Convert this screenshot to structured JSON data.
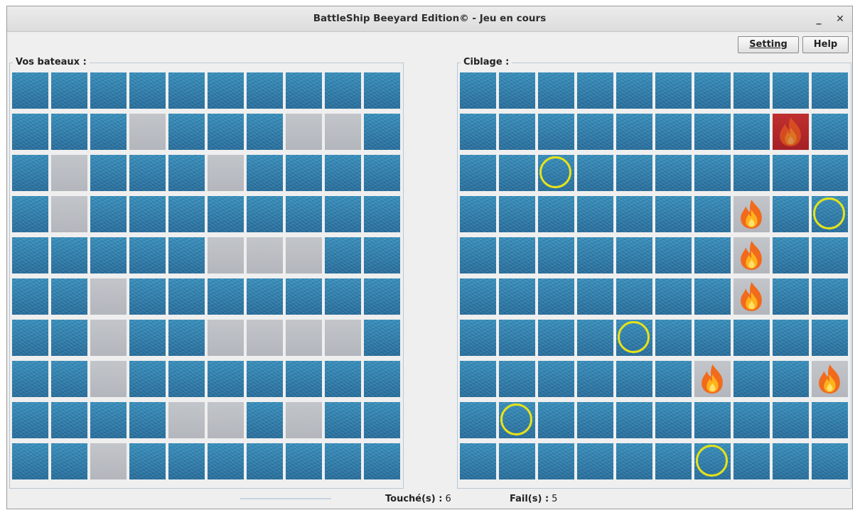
{
  "window": {
    "title": "BattleShip Beeyard Edition© - Jeu en cours",
    "minimize_glyph": "_",
    "close_glyph": "✕"
  },
  "toolbar": {
    "setting_label": "Setting",
    "help_label": "Help"
  },
  "left_panel": {
    "title": "Vos bateaux :",
    "grid": [
      "wwwwwwwwww",
      "wwwswwwssw",
      "wswwwswwww",
      "wswwwwwwww",
      "wwwwwsssww",
      "wwswwwwwww",
      "wwswwssssw",
      "wwswwwwwww",
      "wwwwsswsww",
      "wwswwwwwww"
    ]
  },
  "right_panel": {
    "title": "Ciblage :",
    "grid": [
      "wwwwwwwwww",
      "wwwwwwwwXw",
      "wwowwwwwww",
      "wwwwwwwhwo",
      "wwwwwwwhww",
      "wwwwwwwhww",
      "wwwwowwwww",
      "wwwwwwhwwh",
      "wowwwwwwww",
      "wwwwwwowww"
    ]
  },
  "status": {
    "hits_label": "Touché(s) :",
    "hits_value": "6",
    "fails_label": "Fail(s) :",
    "fails_value": "5"
  },
  "colors": {
    "water": "#2d7aa6",
    "ship": "#b9bcc2",
    "miss_ring": "#e6e21a",
    "sunk": "#b2262c",
    "flame": "#f26a1b"
  },
  "icons": {
    "miss": "ring-marker-icon",
    "hit": "flame-icon"
  }
}
